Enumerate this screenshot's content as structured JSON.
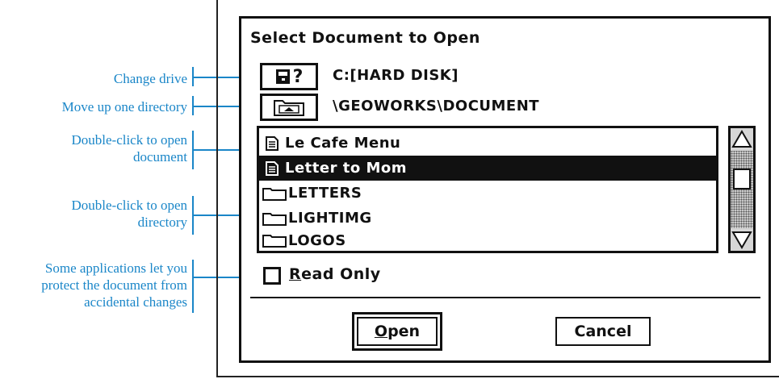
{
  "dialog": {
    "title": "Select Document to Open",
    "drive": {
      "icon": "hard-disk-question-icon",
      "glyph": "?",
      "label": "C:[HARD DISK]"
    },
    "directory": {
      "icon": "folder-up-icon",
      "path": "\\GEOWORKS\\DOCUMENT"
    },
    "files": [
      {
        "name": "Le Cafe Menu",
        "type": "document",
        "icon": "document-icon",
        "selected": false
      },
      {
        "name": "Letter to Mom",
        "type": "document",
        "icon": "document-icon",
        "selected": true
      },
      {
        "name": "LETTERS",
        "type": "folder",
        "icon": "folder-icon",
        "selected": false
      },
      {
        "name": "LIGHTIMG",
        "type": "folder",
        "icon": "folder-icon",
        "selected": false
      },
      {
        "name": "LOGOS",
        "type": "folder",
        "icon": "folder-icon",
        "selected": false
      }
    ],
    "read_only": {
      "label_first": "R",
      "label_rest": "ead Only",
      "checked": false
    },
    "buttons": {
      "open_first": "O",
      "open_rest": "pen",
      "cancel": "Cancel"
    }
  },
  "annotations": {
    "change_drive": "Change drive",
    "move_up": "Move up one directory",
    "open_doc_1": "Double-click to open",
    "open_doc_2": "document",
    "open_dir_1": "Double-click to open",
    "open_dir_2": "directory",
    "read_only_1": "Some applications let you",
    "read_only_2": "protect the document from",
    "read_only_3": "accidental changes"
  },
  "colors": {
    "annotation": "#1a86c8",
    "ink": "#111111",
    "selection": "#111111"
  }
}
